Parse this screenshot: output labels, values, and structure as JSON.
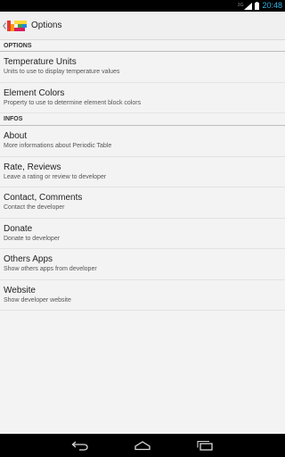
{
  "status_bar": {
    "network": "3G",
    "time": "20:48"
  },
  "action_bar": {
    "title": "Options"
  },
  "sections": [
    {
      "header": "OPTIONS",
      "items": [
        {
          "title": "Temperature Units",
          "summary": "Units to use to display temperature values"
        },
        {
          "title": "Element Colors",
          "summary": "Property to use to determine element block colors"
        }
      ]
    },
    {
      "header": "INFOS",
      "items": [
        {
          "title": "About",
          "summary": "More informations about Periodic Table"
        },
        {
          "title": "Rate, Reviews",
          "summary": "Leave a rating or review to developer"
        },
        {
          "title": "Contact, Comments",
          "summary": "Contact the developer"
        },
        {
          "title": "Donate",
          "summary": "Donate to developer"
        },
        {
          "title": "Others Apps",
          "summary": "Show others apps from developer"
        },
        {
          "title": "Website",
          "summary": "Show developer website"
        }
      ]
    }
  ],
  "icons": {
    "signal": "signal-icon",
    "battery": "battery-icon",
    "up": "up-caret-icon",
    "logo": "periodic-table-logo-icon",
    "back": "back-icon",
    "home": "home-icon",
    "recents": "recent-apps-icon"
  },
  "colors": {
    "accent": "#33b5e5",
    "background": "#f3f3f3"
  }
}
